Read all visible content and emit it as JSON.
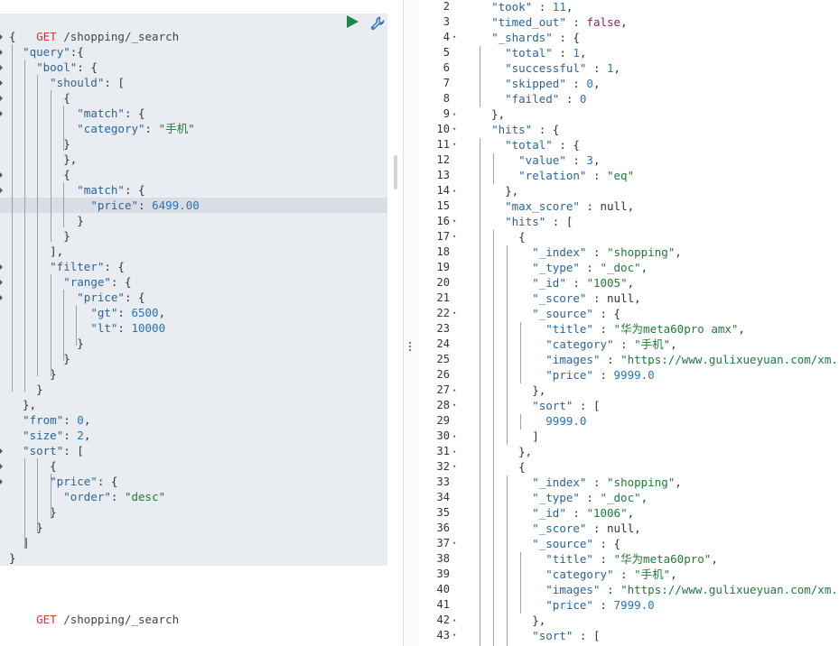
{
  "request": {
    "method": "GET",
    "url": "/shopping/_search",
    "lines": [
      [
        [
          "p",
          "{"
        ]
      ],
      [
        [
          "p",
          "  "
        ],
        [
          "k",
          "\"query\""
        ],
        [
          "p",
          ":{"
        ]
      ],
      [
        [
          "p",
          "    "
        ],
        [
          "k",
          "\"bool\""
        ],
        [
          "p",
          ": {"
        ]
      ],
      [
        [
          "p",
          "      "
        ],
        [
          "k",
          "\"should\""
        ],
        [
          "p",
          ": ["
        ]
      ],
      [
        [
          "p",
          "        {"
        ]
      ],
      [
        [
          "p",
          "          "
        ],
        [
          "k",
          "\"match\""
        ],
        [
          "p",
          ": {"
        ]
      ],
      [
        [
          "p",
          "          "
        ],
        [
          "k",
          "\"category\""
        ],
        [
          "p",
          ": "
        ],
        [
          "s",
          "\"手机\""
        ]
      ],
      [
        [
          "p",
          "        }"
        ]
      ],
      [
        [
          "p",
          "        },"
        ]
      ],
      [
        [
          "p",
          "        {"
        ]
      ],
      [
        [
          "p",
          "          "
        ],
        [
          "k",
          "\"match\""
        ],
        [
          "p",
          ": {"
        ]
      ],
      [
        [
          "p",
          "            "
        ],
        [
          "k",
          "\"price\""
        ],
        [
          "p",
          ": "
        ],
        [
          "n",
          "6499.00"
        ]
      ],
      [
        [
          "p",
          "          }"
        ]
      ],
      [
        [
          "p",
          "        }"
        ]
      ],
      [
        [
          "p",
          "      ],"
        ]
      ],
      [
        [
          "p",
          "      "
        ],
        [
          "k",
          "\"filter\""
        ],
        [
          "p",
          ": {"
        ]
      ],
      [
        [
          "p",
          "        "
        ],
        [
          "k",
          "\"range\""
        ],
        [
          "p",
          ": {"
        ]
      ],
      [
        [
          "p",
          "          "
        ],
        [
          "k",
          "\"price\""
        ],
        [
          "p",
          ": {"
        ]
      ],
      [
        [
          "p",
          "            "
        ],
        [
          "k",
          "\"gt\""
        ],
        [
          "p",
          ": "
        ],
        [
          "n",
          "6500"
        ],
        [
          "p",
          ","
        ]
      ],
      [
        [
          "p",
          "            "
        ],
        [
          "k",
          "\"lt\""
        ],
        [
          "p",
          ": "
        ],
        [
          "n",
          "10000"
        ]
      ],
      [
        [
          "p",
          "          }"
        ]
      ],
      [
        [
          "p",
          "        }"
        ]
      ],
      [
        [
          "p",
          "      }"
        ]
      ],
      [
        [
          "p",
          "    }"
        ]
      ],
      [
        [
          "p",
          "  },"
        ]
      ],
      [
        [
          "p",
          "  "
        ],
        [
          "k",
          "\"from\""
        ],
        [
          "p",
          ": "
        ],
        [
          "n",
          "0"
        ],
        [
          "p",
          ","
        ]
      ],
      [
        [
          "p",
          "  "
        ],
        [
          "k",
          "\"size\""
        ],
        [
          "p",
          ": "
        ],
        [
          "n",
          "2"
        ],
        [
          "p",
          ","
        ]
      ],
      [
        [
          "p",
          "  "
        ],
        [
          "k",
          "\"sort\""
        ],
        [
          "p",
          ": ["
        ]
      ],
      [
        [
          "p",
          "      {"
        ]
      ],
      [
        [
          "p",
          "      "
        ],
        [
          "k",
          "\"price\""
        ],
        [
          "p",
          ": {"
        ]
      ],
      [
        [
          "p",
          "        "
        ],
        [
          "k",
          "\"order\""
        ],
        [
          "p",
          ": "
        ],
        [
          "s",
          "\"desc\""
        ]
      ],
      [
        [
          "p",
          "      }"
        ]
      ],
      [
        [
          "p",
          "    }"
        ]
      ],
      [
        [
          "p",
          "  ]"
        ]
      ],
      [
        [
          "p",
          "}"
        ]
      ]
    ]
  },
  "request2": {
    "method": "GET",
    "url": "/shopping/_search"
  },
  "response": {
    "lines": [
      {
        "n": "2",
        "f": "",
        "c": [
          [
            "p",
            "  "
          ],
          [
            "k",
            "\"took\""
          ],
          [
            "p",
            " : "
          ],
          [
            "n",
            "11"
          ],
          [
            "p",
            ","
          ]
        ]
      },
      {
        "n": "3",
        "f": "",
        "c": [
          [
            "p",
            "  "
          ],
          [
            "k",
            "\"timed_out\""
          ],
          [
            "p",
            " : "
          ],
          [
            "kw",
            "false"
          ],
          [
            "p",
            ","
          ]
        ]
      },
      {
        "n": "4",
        "f": "▾",
        "c": [
          [
            "p",
            "  "
          ],
          [
            "k",
            "\"_shards\""
          ],
          [
            "p",
            " : {"
          ]
        ]
      },
      {
        "n": "5",
        "f": "",
        "c": [
          [
            "p",
            "    "
          ],
          [
            "k",
            "\"total\""
          ],
          [
            "p",
            " : "
          ],
          [
            "n",
            "1"
          ],
          [
            "p",
            ","
          ]
        ]
      },
      {
        "n": "6",
        "f": "",
        "c": [
          [
            "p",
            "    "
          ],
          [
            "k",
            "\"successful\""
          ],
          [
            "p",
            " : "
          ],
          [
            "n",
            "1"
          ],
          [
            "p",
            ","
          ]
        ]
      },
      {
        "n": "7",
        "f": "",
        "c": [
          [
            "p",
            "    "
          ],
          [
            "k",
            "\"skipped\""
          ],
          [
            "p",
            " : "
          ],
          [
            "n",
            "0"
          ],
          [
            "p",
            ","
          ]
        ]
      },
      {
        "n": "8",
        "f": "",
        "c": [
          [
            "p",
            "    "
          ],
          [
            "k",
            "\"failed\""
          ],
          [
            "p",
            " : "
          ],
          [
            "n",
            "0"
          ]
        ]
      },
      {
        "n": "9",
        "f": "▴",
        "c": [
          [
            "p",
            "  },"
          ]
        ]
      },
      {
        "n": "10",
        "f": "▾",
        "c": [
          [
            "p",
            "  "
          ],
          [
            "k",
            "\"hits\""
          ],
          [
            "p",
            " : {"
          ]
        ]
      },
      {
        "n": "11",
        "f": "▾",
        "c": [
          [
            "p",
            "    "
          ],
          [
            "k",
            "\"total\""
          ],
          [
            "p",
            " : {"
          ]
        ]
      },
      {
        "n": "12",
        "f": "",
        "c": [
          [
            "p",
            "      "
          ],
          [
            "k",
            "\"value\""
          ],
          [
            "p",
            " : "
          ],
          [
            "n",
            "3"
          ],
          [
            "p",
            ","
          ]
        ]
      },
      {
        "n": "13",
        "f": "",
        "c": [
          [
            "p",
            "      "
          ],
          [
            "k",
            "\"relation\""
          ],
          [
            "p",
            " : "
          ],
          [
            "s",
            "\"eq\""
          ]
        ]
      },
      {
        "n": "14",
        "f": "▴",
        "c": [
          [
            "p",
            "    },"
          ]
        ]
      },
      {
        "n": "15",
        "f": "",
        "c": [
          [
            "p",
            "    "
          ],
          [
            "k",
            "\"max_score\""
          ],
          [
            "p",
            " : "
          ],
          [
            "p",
            "null"
          ],
          [
            "p",
            ","
          ]
        ]
      },
      {
        "n": "16",
        "f": "▾",
        "c": [
          [
            "p",
            "    "
          ],
          [
            "k",
            "\"hits\""
          ],
          [
            "p",
            " : ["
          ]
        ]
      },
      {
        "n": "17",
        "f": "▾",
        "c": [
          [
            "p",
            "      {"
          ]
        ]
      },
      {
        "n": "18",
        "f": "",
        "c": [
          [
            "p",
            "        "
          ],
          [
            "k",
            "\"_index\""
          ],
          [
            "p",
            " : "
          ],
          [
            "s",
            "\"shopping\""
          ],
          [
            "p",
            ","
          ]
        ]
      },
      {
        "n": "19",
        "f": "",
        "c": [
          [
            "p",
            "        "
          ],
          [
            "k",
            "\"_type\""
          ],
          [
            "p",
            " : "
          ],
          [
            "s",
            "\"_doc\""
          ],
          [
            "p",
            ","
          ]
        ]
      },
      {
        "n": "20",
        "f": "",
        "c": [
          [
            "p",
            "        "
          ],
          [
            "k",
            "\"_id\""
          ],
          [
            "p",
            " : "
          ],
          [
            "s",
            "\"1005\""
          ],
          [
            "p",
            ","
          ]
        ]
      },
      {
        "n": "21",
        "f": "",
        "c": [
          [
            "p",
            "        "
          ],
          [
            "k",
            "\"_score\""
          ],
          [
            "p",
            " : "
          ],
          [
            "p",
            "null"
          ],
          [
            "p",
            ","
          ]
        ]
      },
      {
        "n": "22",
        "f": "▾",
        "c": [
          [
            "p",
            "        "
          ],
          [
            "k",
            "\"_source\""
          ],
          [
            "p",
            " : {"
          ]
        ]
      },
      {
        "n": "23",
        "f": "",
        "c": [
          [
            "p",
            "          "
          ],
          [
            "k",
            "\"title\""
          ],
          [
            "p",
            " : "
          ],
          [
            "s",
            "\"华为meta60pro amx\""
          ],
          [
            "p",
            ","
          ]
        ]
      },
      {
        "n": "24",
        "f": "",
        "c": [
          [
            "p",
            "          "
          ],
          [
            "k",
            "\"category\""
          ],
          [
            "p",
            " : "
          ],
          [
            "s",
            "\"手机\""
          ],
          [
            "p",
            ","
          ]
        ]
      },
      {
        "n": "25",
        "f": "",
        "c": [
          [
            "p",
            "          "
          ],
          [
            "k",
            "\"images\""
          ],
          [
            "p",
            " : "
          ],
          [
            "s",
            "\"https://www.gulixueyuan.com/xm.jpg\""
          ],
          [
            "p",
            ","
          ]
        ]
      },
      {
        "n": "26",
        "f": "",
        "c": [
          [
            "p",
            "          "
          ],
          [
            "k",
            "\"price\""
          ],
          [
            "p",
            " : "
          ],
          [
            "n",
            "9999.0"
          ]
        ]
      },
      {
        "n": "27",
        "f": "▴",
        "c": [
          [
            "p",
            "        },"
          ]
        ]
      },
      {
        "n": "28",
        "f": "▾",
        "c": [
          [
            "p",
            "        "
          ],
          [
            "k",
            "\"sort\""
          ],
          [
            "p",
            " : ["
          ]
        ]
      },
      {
        "n": "29",
        "f": "",
        "c": [
          [
            "p",
            "          "
          ],
          [
            "n",
            "9999.0"
          ]
        ]
      },
      {
        "n": "30",
        "f": "▴",
        "c": [
          [
            "p",
            "        ]"
          ]
        ]
      },
      {
        "n": "31",
        "f": "▴",
        "c": [
          [
            "p",
            "      },"
          ]
        ]
      },
      {
        "n": "32",
        "f": "▾",
        "c": [
          [
            "p",
            "      {"
          ]
        ]
      },
      {
        "n": "33",
        "f": "",
        "c": [
          [
            "p",
            "        "
          ],
          [
            "k",
            "\"_index\""
          ],
          [
            "p",
            " : "
          ],
          [
            "s",
            "\"shopping\""
          ],
          [
            "p",
            ","
          ]
        ]
      },
      {
        "n": "34",
        "f": "",
        "c": [
          [
            "p",
            "        "
          ],
          [
            "k",
            "\"_type\""
          ],
          [
            "p",
            " : "
          ],
          [
            "s",
            "\"_doc\""
          ],
          [
            "p",
            ","
          ]
        ]
      },
      {
        "n": "35",
        "f": "",
        "c": [
          [
            "p",
            "        "
          ],
          [
            "k",
            "\"_id\""
          ],
          [
            "p",
            " : "
          ],
          [
            "s",
            "\"1006\""
          ],
          [
            "p",
            ","
          ]
        ]
      },
      {
        "n": "36",
        "f": "",
        "c": [
          [
            "p",
            "        "
          ],
          [
            "k",
            "\"_score\""
          ],
          [
            "p",
            " : "
          ],
          [
            "p",
            "null"
          ],
          [
            "p",
            ","
          ]
        ]
      },
      {
        "n": "37",
        "f": "▾",
        "c": [
          [
            "p",
            "        "
          ],
          [
            "k",
            "\"_source\""
          ],
          [
            "p",
            " : {"
          ]
        ]
      },
      {
        "n": "38",
        "f": "",
        "c": [
          [
            "p",
            "          "
          ],
          [
            "k",
            "\"title\""
          ],
          [
            "p",
            " : "
          ],
          [
            "s",
            "\"华为meta60pro\""
          ],
          [
            "p",
            ","
          ]
        ]
      },
      {
        "n": "39",
        "f": "",
        "c": [
          [
            "p",
            "          "
          ],
          [
            "k",
            "\"category\""
          ],
          [
            "p",
            " : "
          ],
          [
            "s",
            "\"手机\""
          ],
          [
            "p",
            ","
          ]
        ]
      },
      {
        "n": "40",
        "f": "",
        "c": [
          [
            "p",
            "          "
          ],
          [
            "k",
            "\"images\""
          ],
          [
            "p",
            " : "
          ],
          [
            "s",
            "\"https://www.gulixueyuan.com/xm.jpg\""
          ],
          [
            "p",
            ","
          ]
        ]
      },
      {
        "n": "41",
        "f": "",
        "c": [
          [
            "p",
            "          "
          ],
          [
            "k",
            "\"price\""
          ],
          [
            "p",
            " : "
          ],
          [
            "n",
            "7999.0"
          ]
        ]
      },
      {
        "n": "42",
        "f": "▴",
        "c": [
          [
            "p",
            "        },"
          ]
        ]
      },
      {
        "n": "43",
        "f": "▾",
        "c": [
          [
            "p",
            "        "
          ],
          [
            "k",
            "\"sort\""
          ],
          [
            "p",
            " : ["
          ]
        ]
      }
    ]
  },
  "icons": {
    "run": "play-icon",
    "settings": "wrench-icon"
  },
  "colors": {
    "method": "#c43d3d",
    "key": "#2a6496",
    "string": "#1f7a3a",
    "number": "#2674b5",
    "run_button": "#1a8a4a",
    "request_background": "#e9ecf1"
  }
}
